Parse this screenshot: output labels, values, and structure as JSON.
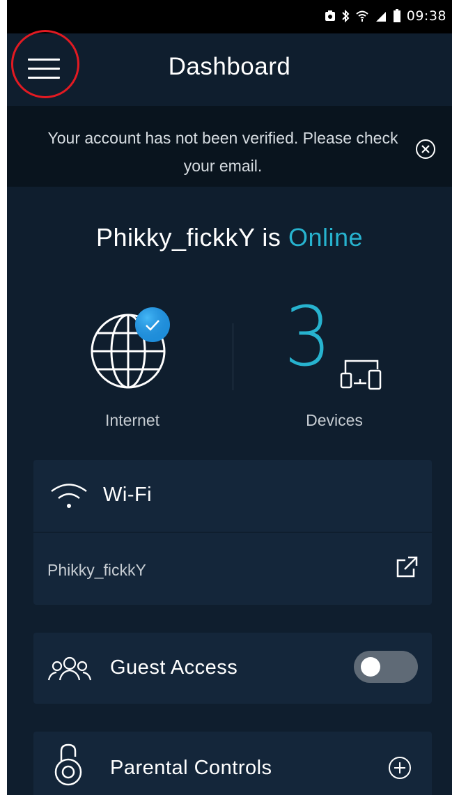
{
  "status_bar": {
    "time": "09:38",
    "icons": [
      "screenshot-icon",
      "bluetooth-icon",
      "wifi-icon",
      "signal-icon",
      "battery-icon"
    ]
  },
  "app_bar": {
    "title": "Dashboard",
    "menu_icon": "hamburger-menu-icon",
    "highlight_color": "#e21a22"
  },
  "banner": {
    "message": "Your account has not been verified. Please check your email.",
    "close_icon": "close-circle-icon"
  },
  "network_status": {
    "network_name": "Phikky_fickkY",
    "connector": "is",
    "status": "Online",
    "status_color": "#27b3cf"
  },
  "stats": {
    "internet": {
      "label": "Internet",
      "icon": "globe-icon",
      "badge_icon": "checkmark-badge-icon"
    },
    "devices": {
      "label": "Devices",
      "count": "3",
      "icon": "devices-icon"
    }
  },
  "wifi": {
    "label": "Wi-Fi",
    "icon": "wifi-icon",
    "network": "Phikky_fickkY",
    "link_icon": "external-link-icon"
  },
  "guest_access": {
    "label": "Guest Access",
    "icon": "guests-icon",
    "enabled": false
  },
  "parental_controls": {
    "label": "Parental Controls",
    "icon": "padlock-icon",
    "action_icon": "add-circle-icon"
  },
  "colors": {
    "background": "#0f1e2e",
    "card": "#14263a",
    "banner": "#09141e",
    "accent": "#27b3cf"
  }
}
